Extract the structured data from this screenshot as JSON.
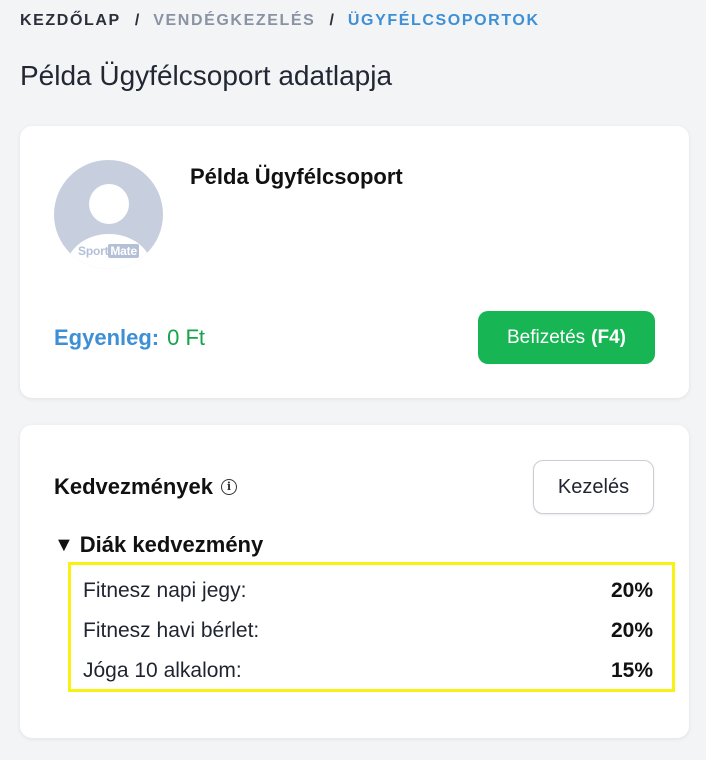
{
  "breadcrumb": {
    "home": "Kezdőlap",
    "section": "Vendégkezelés",
    "current": "Ügyfélcsoportok",
    "separator": "/"
  },
  "page": {
    "title": "Példa Ügyfélcsoport adatlapja"
  },
  "profile": {
    "name": "Példa Ügyfélcsoport",
    "avatar_brand_a": "Sport",
    "avatar_brand_b": "Mate",
    "balance_label": "Egyenleg:",
    "balance_value": "0 Ft",
    "pay_button_label": "Befizetés",
    "pay_button_key": "(F4)"
  },
  "discounts": {
    "title": "Kedvezmények",
    "info_icon_glyph": "i",
    "manage_button_label": "Kezelés",
    "group": {
      "caret": "▼",
      "name": "Diák kedvezmény",
      "items": [
        {
          "name": "Fitnesz napi jegy:",
          "value": "20%"
        },
        {
          "name": "Fitnesz havi bérlet:",
          "value": "20%"
        },
        {
          "name": "Jóga 10 alkalom:",
          "value": "15%"
        }
      ]
    }
  },
  "colors": {
    "accent_blue": "#3d8fd6",
    "success_green": "#17b554",
    "highlight_yellow": "#f7f212"
  }
}
